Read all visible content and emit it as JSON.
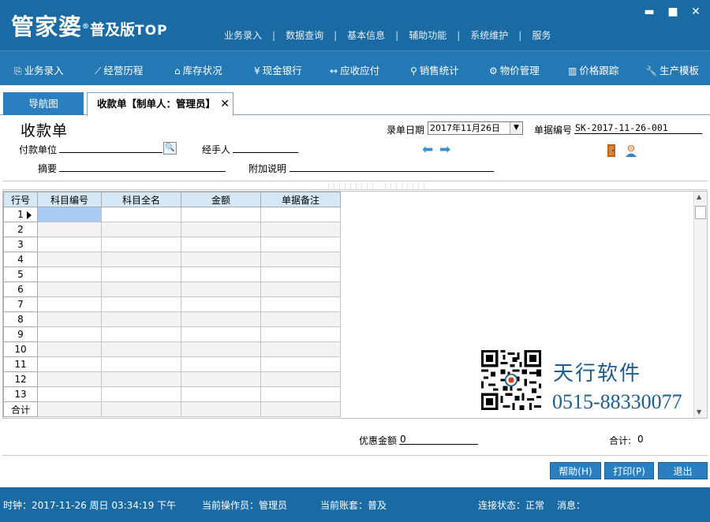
{
  "title_bar": {
    "logo_main": "管家婆",
    "logo_reg": "®",
    "logo_sub": "普及版",
    "logo_top": "TOP",
    "menu": [
      "业务录入",
      "数据查询",
      "基本信息",
      "辅助功能",
      "系统维护",
      "服务"
    ],
    "separator": "|",
    "window_controls": {
      "minimize": "▬",
      "maximize": "■",
      "close": "✕"
    }
  },
  "toolbar": {
    "items": [
      {
        "icon": "⎘",
        "label": "业务录入"
      },
      {
        "icon": "⟋",
        "label": "经营历程"
      },
      {
        "icon": "⌂",
        "label": "库存状况"
      },
      {
        "icon": "¥",
        "label": "现金银行"
      },
      {
        "icon": "↔",
        "label": "应收应付"
      },
      {
        "icon": "⚲",
        "label": "销售统计"
      },
      {
        "icon": "⚙",
        "label": "物价管理"
      },
      {
        "icon": "▥",
        "label": "价格跟踪"
      },
      {
        "icon": "🔧",
        "label": "生产模板"
      }
    ]
  },
  "tabs": {
    "nav": "导航图",
    "document": "收款单【制单人：管理员】",
    "close": "✕"
  },
  "form": {
    "title": "收款单",
    "date_label": "录单日期",
    "date_value": "2017年11月26日",
    "dropdown_glyph": "▼",
    "docno_label": "单据编号",
    "docno_value": "SK-2017-11-26-001",
    "payer_label": "付款单位",
    "search_glyph": "🔍",
    "handler_label": "经手人",
    "summary_label": "摘要",
    "note_label": "附加说明",
    "prev_glyph": "⬅",
    "next_glyph": "➡"
  },
  "grid": {
    "columns": [
      "行号",
      "科目编号",
      "科目全名",
      "金额",
      "单据备注"
    ],
    "rows": [
      "1",
      "2",
      "3",
      "4",
      "5",
      "6",
      "7",
      "8",
      "9",
      "10",
      "11",
      "12",
      "13"
    ],
    "total_label": "合计",
    "scroll_up": "▲",
    "scroll_down": "▼"
  },
  "brand": {
    "name": "天行软件",
    "phone": "0515-88330077"
  },
  "footer": {
    "discount_label": "优惠金额",
    "discount_value": "0",
    "total_label": "合计:",
    "total_value": "0"
  },
  "buttons": {
    "help": "帮助(H)",
    "print": "打印(P)",
    "exit": "退出"
  },
  "status": {
    "clock": "时钟：2017-11-26 周日 03:34:19 下午",
    "operator": "当前操作员：管理员",
    "account": "当前账套：普及",
    "connection": "连接状态：正常",
    "message": "消息："
  }
}
